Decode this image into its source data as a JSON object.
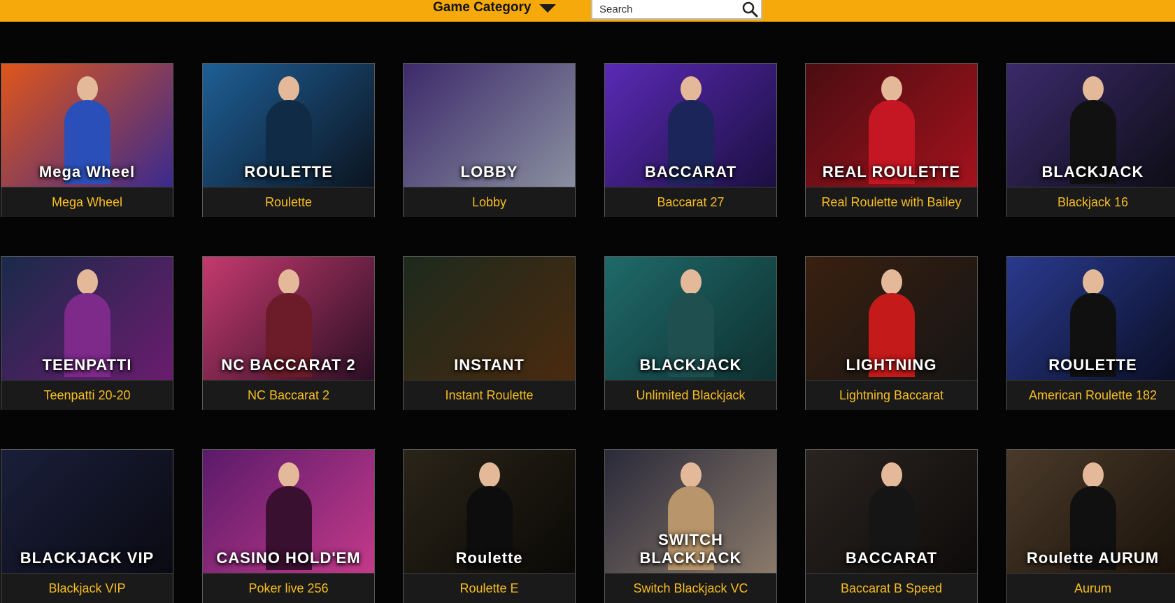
{
  "header": {
    "category_label": "Game Category",
    "search_placeholder": "Search"
  },
  "games": [
    {
      "label": "Mega Wheel",
      "art_text": "Mega Wheel",
      "bg1": "#e0561b",
      "bg2": "#3a2a8e",
      "figure": "#2b4fb8"
    },
    {
      "label": "Roulette",
      "art_text": "ROULETTE",
      "bg1": "#1e5f96",
      "bg2": "#0c1420",
      "figure": "#0f2b45"
    },
    {
      "label": "Lobby",
      "art_text": "LOBBY",
      "bg1": "#3c2a6a",
      "bg2": "#8a8fa0",
      "figure": ""
    },
    {
      "label": "Baccarat 27",
      "art_text": "BACCARAT",
      "bg1": "#5a2ab5",
      "bg2": "#1b0f40",
      "figure": "#1c2559"
    },
    {
      "label": "Real Roulette with Bailey",
      "art_text": "REAL ROULETTE",
      "bg1": "#4a0d12",
      "bg2": "#a3121c",
      "figure": "#c41623"
    },
    {
      "label": "Blackjack 16",
      "art_text": "BLACKJACK",
      "bg1": "#3b2a6b",
      "bg2": "#0d0d15",
      "figure": "#111111"
    },
    {
      "label": "Teenpatti 20-20",
      "art_text": "TEENPATTI",
      "bg1": "#1a2a4a",
      "bg2": "#6a1c6e",
      "figure": "#7d2a8b"
    },
    {
      "label": "NC Baccarat 2",
      "art_text": "NC BACCARAT 2",
      "bg1": "#c43a6e",
      "bg2": "#2a0f24",
      "figure": "#6b1c28"
    },
    {
      "label": "Instant Roulette",
      "art_text": "INSTANT",
      "bg1": "#1d2a1d",
      "bg2": "#4a2a0f",
      "figure": ""
    },
    {
      "label": "Unlimited Blackjack",
      "art_text": "BLACKJACK",
      "bg1": "#1f6a6a",
      "bg2": "#0f3030",
      "figure": "#1f4f4f"
    },
    {
      "label": "Lightning Baccarat",
      "art_text": "LIGHTNING",
      "bg1": "#3a2010",
      "bg2": "#151515",
      "figure": "#c41a1a"
    },
    {
      "label": "American Roulette 182",
      "art_text": "ROULETTE",
      "bg1": "#2a3a8e",
      "bg2": "#0a0f25",
      "figure": "#101010"
    },
    {
      "label": "Blackjack VIP",
      "art_text": "BLACKJACK VIP",
      "bg1": "#1a1f3a",
      "bg2": "#0a0a12",
      "figure": ""
    },
    {
      "label": "Poker live 256",
      "art_text": "CASINO HOLD'EM",
      "bg1": "#5a1a6a",
      "bg2": "#c43a8a",
      "figure": "#3a1030"
    },
    {
      "label": "Roulette E",
      "art_text": "Roulette",
      "bg1": "#2a2418",
      "bg2": "#0a0906",
      "figure": "#0d0d0d"
    },
    {
      "label": "Switch Blackjack VC",
      "art_text": "SWITCH BLACKJACK",
      "bg1": "#2a2a3a",
      "bg2": "#8a7a6a",
      "figure": "#b8956a"
    },
    {
      "label": "Baccarat B Speed",
      "art_text": "BACCARAT",
      "bg1": "#2a2420",
      "bg2": "#0d0b0a",
      "figure": "#151515"
    },
    {
      "label": "Aurum",
      "art_text": "Roulette AURUM",
      "bg1": "#4a3a2a",
      "bg2": "#1a120a",
      "figure": "#101010"
    }
  ]
}
